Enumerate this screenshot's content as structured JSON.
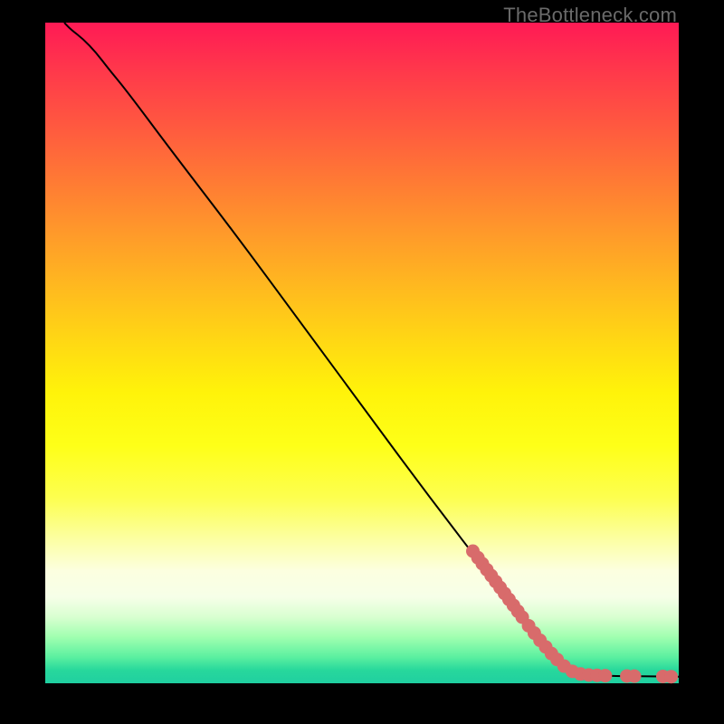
{
  "watermark": "TheBottleneck.com",
  "colors": {
    "curve": "#000000",
    "point_fill": "#d86b6b",
    "point_stroke": "#c95a5a"
  },
  "chart_data": {
    "type": "line",
    "title": "",
    "xlabel": "",
    "ylabel": "",
    "xlim": [
      0,
      100
    ],
    "ylim": [
      0,
      100
    ],
    "curve": [
      {
        "x": 3,
        "y": 100
      },
      {
        "x": 4,
        "y": 99
      },
      {
        "x": 6,
        "y": 97.5
      },
      {
        "x": 8,
        "y": 95.5
      },
      {
        "x": 10,
        "y": 93
      },
      {
        "x": 13,
        "y": 89.5
      },
      {
        "x": 20,
        "y": 80.5
      },
      {
        "x": 30,
        "y": 68
      },
      {
        "x": 40,
        "y": 55
      },
      {
        "x": 50,
        "y": 42
      },
      {
        "x": 60,
        "y": 29
      },
      {
        "x": 70,
        "y": 16.5
      },
      {
        "x": 78,
        "y": 6.5
      },
      {
        "x": 82,
        "y": 2.5
      },
      {
        "x": 84,
        "y": 1.5
      },
      {
        "x": 86,
        "y": 1.2
      },
      {
        "x": 90,
        "y": 1.1
      },
      {
        "x": 95,
        "y": 1.05
      },
      {
        "x": 100,
        "y": 1.0
      }
    ],
    "points": [
      {
        "x": 67.5,
        "y": 20.0
      },
      {
        "x": 68.3,
        "y": 19.0
      },
      {
        "x": 69.0,
        "y": 18.1
      },
      {
        "x": 69.7,
        "y": 17.2
      },
      {
        "x": 70.4,
        "y": 16.3
      },
      {
        "x": 71.1,
        "y": 15.4
      },
      {
        "x": 71.8,
        "y": 14.5
      },
      {
        "x": 72.5,
        "y": 13.6
      },
      {
        "x": 73.2,
        "y": 12.7
      },
      {
        "x": 73.9,
        "y": 11.8
      },
      {
        "x": 74.6,
        "y": 10.9
      },
      {
        "x": 75.3,
        "y": 10.0
      },
      {
        "x": 76.3,
        "y": 8.7
      },
      {
        "x": 77.2,
        "y": 7.6
      },
      {
        "x": 78.1,
        "y": 6.5
      },
      {
        "x": 79.0,
        "y": 5.5
      },
      {
        "x": 79.9,
        "y": 4.5
      },
      {
        "x": 80.8,
        "y": 3.6
      },
      {
        "x": 81.9,
        "y": 2.6
      },
      {
        "x": 83.2,
        "y": 1.8
      },
      {
        "x": 84.5,
        "y": 1.4
      },
      {
        "x": 85.8,
        "y": 1.25
      },
      {
        "x": 87.1,
        "y": 1.2
      },
      {
        "x": 88.4,
        "y": 1.15
      },
      {
        "x": 91.8,
        "y": 1.1
      },
      {
        "x": 93.0,
        "y": 1.08
      },
      {
        "x": 97.5,
        "y": 1.03
      },
      {
        "x": 98.8,
        "y": 1.0
      }
    ],
    "point_radius": 7.5
  }
}
